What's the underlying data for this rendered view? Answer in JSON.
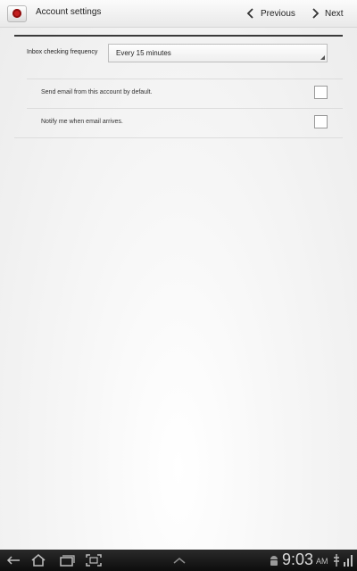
{
  "header": {
    "title": "Account settings",
    "prev_label": "Previous",
    "next_label": "Next"
  },
  "frequency": {
    "label": "Inbox checking frequency",
    "value": "Every 15 minutes"
  },
  "options": [
    {
      "label": "Send email from this account by default.",
      "checked": false
    },
    {
      "label": "Notify me when email arrives.",
      "checked": false
    }
  ],
  "status_bar": {
    "time": "9:03",
    "ampm": "AM"
  },
  "colors": {
    "app_icon": "#c41e1e"
  }
}
